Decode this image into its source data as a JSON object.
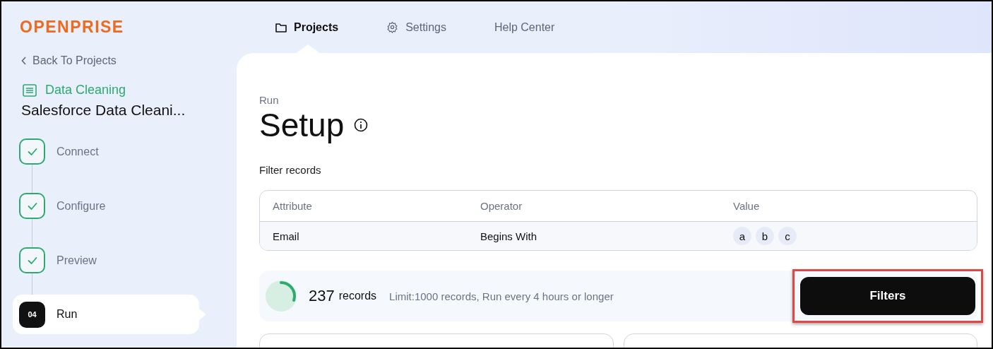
{
  "logo": "OPENPRISE",
  "nav": [
    {
      "label": "Projects",
      "kind": "folder",
      "selected": true
    },
    {
      "label": "Settings",
      "kind": "gear",
      "selected": false
    },
    {
      "label": "Help Center",
      "kind": "plain",
      "selected": false
    }
  ],
  "sidebar": {
    "back_link": "Back To Projects",
    "category": "Data Cleaning",
    "project_title": "Salesforce Data Cleani...",
    "steps": [
      {
        "kind": "done",
        "label": "Connect",
        "selected": false
      },
      {
        "kind": "done",
        "label": "Configure",
        "selected": false
      },
      {
        "kind": "done",
        "label": "Preview",
        "selected": false
      },
      {
        "kind": "numbered",
        "number": "04",
        "label": "Run",
        "selected": true
      }
    ]
  },
  "main": {
    "breadcrumb": "Run",
    "title": "Setup",
    "section_label": "Filter records",
    "filter_table": {
      "columns": [
        "Attribute",
        "Operator",
        "Value"
      ],
      "rows": [
        {
          "attribute": "Email",
          "operator": "Begins With",
          "values": [
            "a",
            "b",
            "c"
          ]
        }
      ]
    },
    "summary": {
      "level": 0.3,
      "count": "237",
      "count_unit": "records",
      "limit_text": "Limit:1000 records, Run every 4 hours or longer",
      "button": "Filters",
      "highlighted": true
    }
  }
}
